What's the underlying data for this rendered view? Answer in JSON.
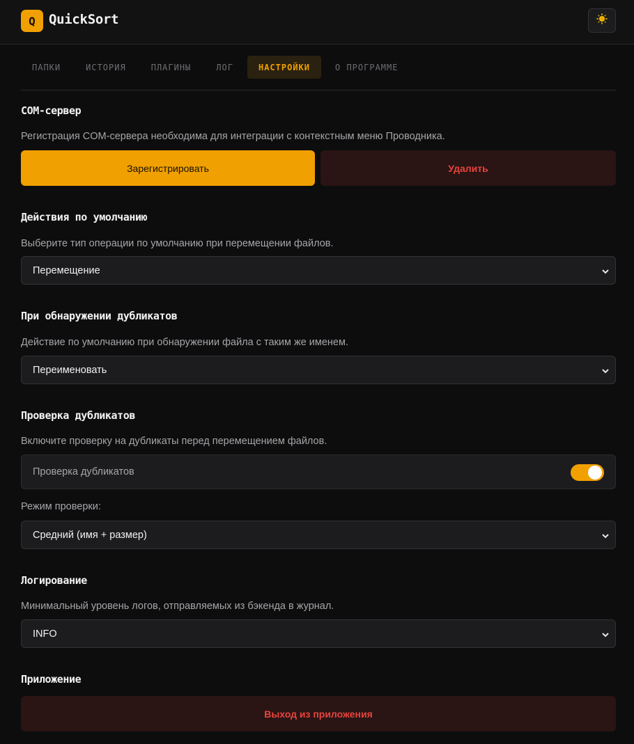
{
  "app": {
    "logo_letter": "Q",
    "title": "QuickSort"
  },
  "header": {
    "theme_icon": "sun-icon"
  },
  "tabs": [
    {
      "label": "ПАПКИ"
    },
    {
      "label": "ИСТОРИЯ"
    },
    {
      "label": "ПЛАГИНЫ"
    },
    {
      "label": "ЛОГ"
    },
    {
      "label": "НАСТРОЙКИ",
      "active": true
    },
    {
      "label": "О ПРОГРАММЕ"
    }
  ],
  "com_server": {
    "title": "COM-сервер",
    "description": "Регистрация COM-сервера необходима для интеграции с контекстным меню Проводника.",
    "register_label": "Зарегистрировать",
    "remove_label": "Удалить"
  },
  "default_action": {
    "title": "Действия по умолчанию",
    "description": "Выберите тип операции по умолчанию при перемещении файлов.",
    "selected": "Перемещение"
  },
  "on_duplicate": {
    "title": "При обнаружении дубликатов",
    "description": "Действие по умолчанию при обнаружении файла с таким же именем.",
    "selected": "Переименовать"
  },
  "duplicate_check": {
    "title": "Проверка дубликатов",
    "description": "Включите проверку на дубликаты перед перемещением файлов.",
    "toggle_label": "Проверка дубликатов",
    "toggle_on": true,
    "mode_label": "Режим проверки:",
    "mode_selected": "Средний (имя + размер)"
  },
  "logging": {
    "title": "Логирование",
    "description": "Минимальный уровень логов, отправляемых из бэкенда в журнал.",
    "selected": "INFO"
  },
  "application": {
    "title": "Приложение",
    "exit_label": "Выход из приложения"
  },
  "colors": {
    "accent": "#f0a000",
    "danger": "#e8443c",
    "background": "#0d0d0e"
  }
}
